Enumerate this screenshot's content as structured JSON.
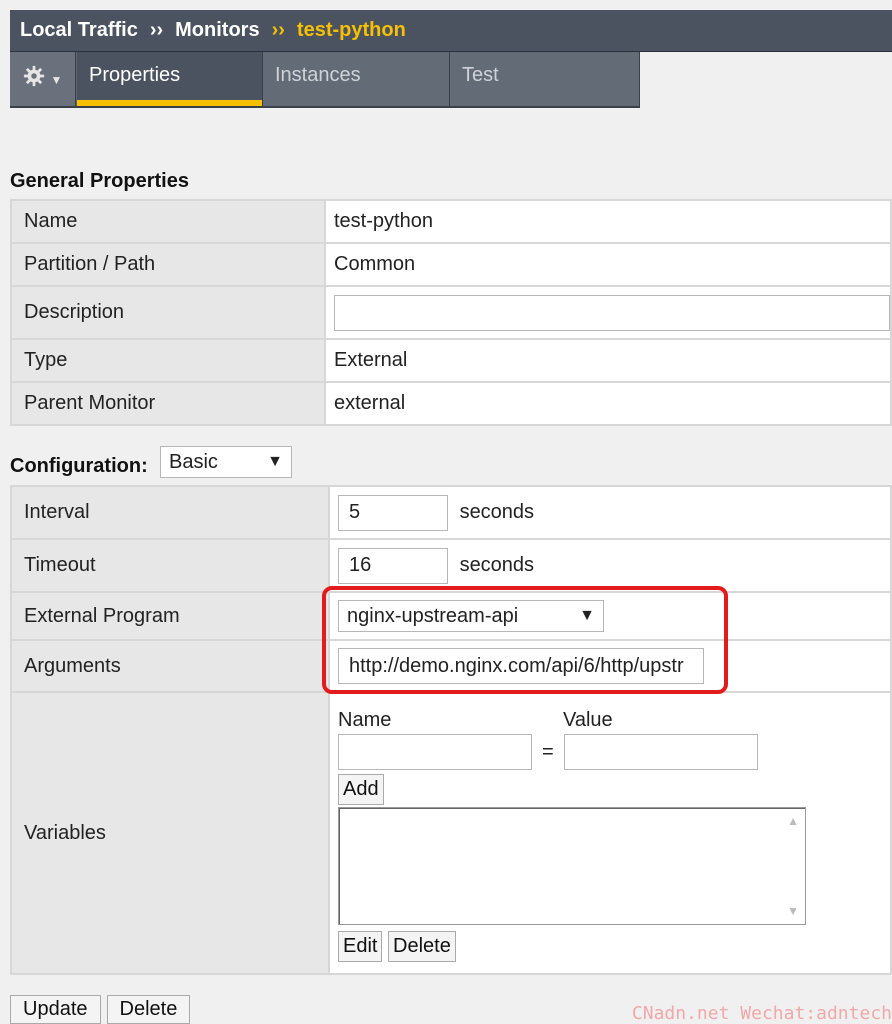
{
  "breadcrumb": {
    "part1": "Local Traffic",
    "sep": "››",
    "part2": "Monitors",
    "current": "test-python"
  },
  "tabs": {
    "properties": "Properties",
    "instances": "Instances",
    "test": "Test"
  },
  "general": {
    "title": "General Properties",
    "name_label": "Name",
    "name_value": "test-python",
    "partition_label": "Partition / Path",
    "partition_value": "Common",
    "description_label": "Description",
    "description_value": "",
    "type_label": "Type",
    "type_value": "External",
    "parent_label": "Parent Monitor",
    "parent_value": "external"
  },
  "configuration": {
    "title": "Configuration:",
    "mode": "Basic",
    "interval_label": "Interval",
    "interval_value": "5",
    "interval_unit": "seconds",
    "timeout_label": "Timeout",
    "timeout_value": "16",
    "timeout_unit": "seconds",
    "program_label": "External Program",
    "program_value": "nginx-upstream-api",
    "arguments_label": "Arguments",
    "arguments_value": "http://demo.nginx.com/api/6/http/upstr",
    "variables_label": "Variables",
    "var_name_header": "Name",
    "var_value_header": "Value",
    "equals": "=",
    "add_button": "Add",
    "edit_button": "Edit",
    "delete_button": "Delete"
  },
  "actions": {
    "update": "Update",
    "delete": "Delete"
  },
  "watermark": "CNadn.net Wechat:adntech",
  "colors": {
    "header_bg": "#4b5360",
    "accent": "#f7c000",
    "highlight": "#e21c1c"
  }
}
